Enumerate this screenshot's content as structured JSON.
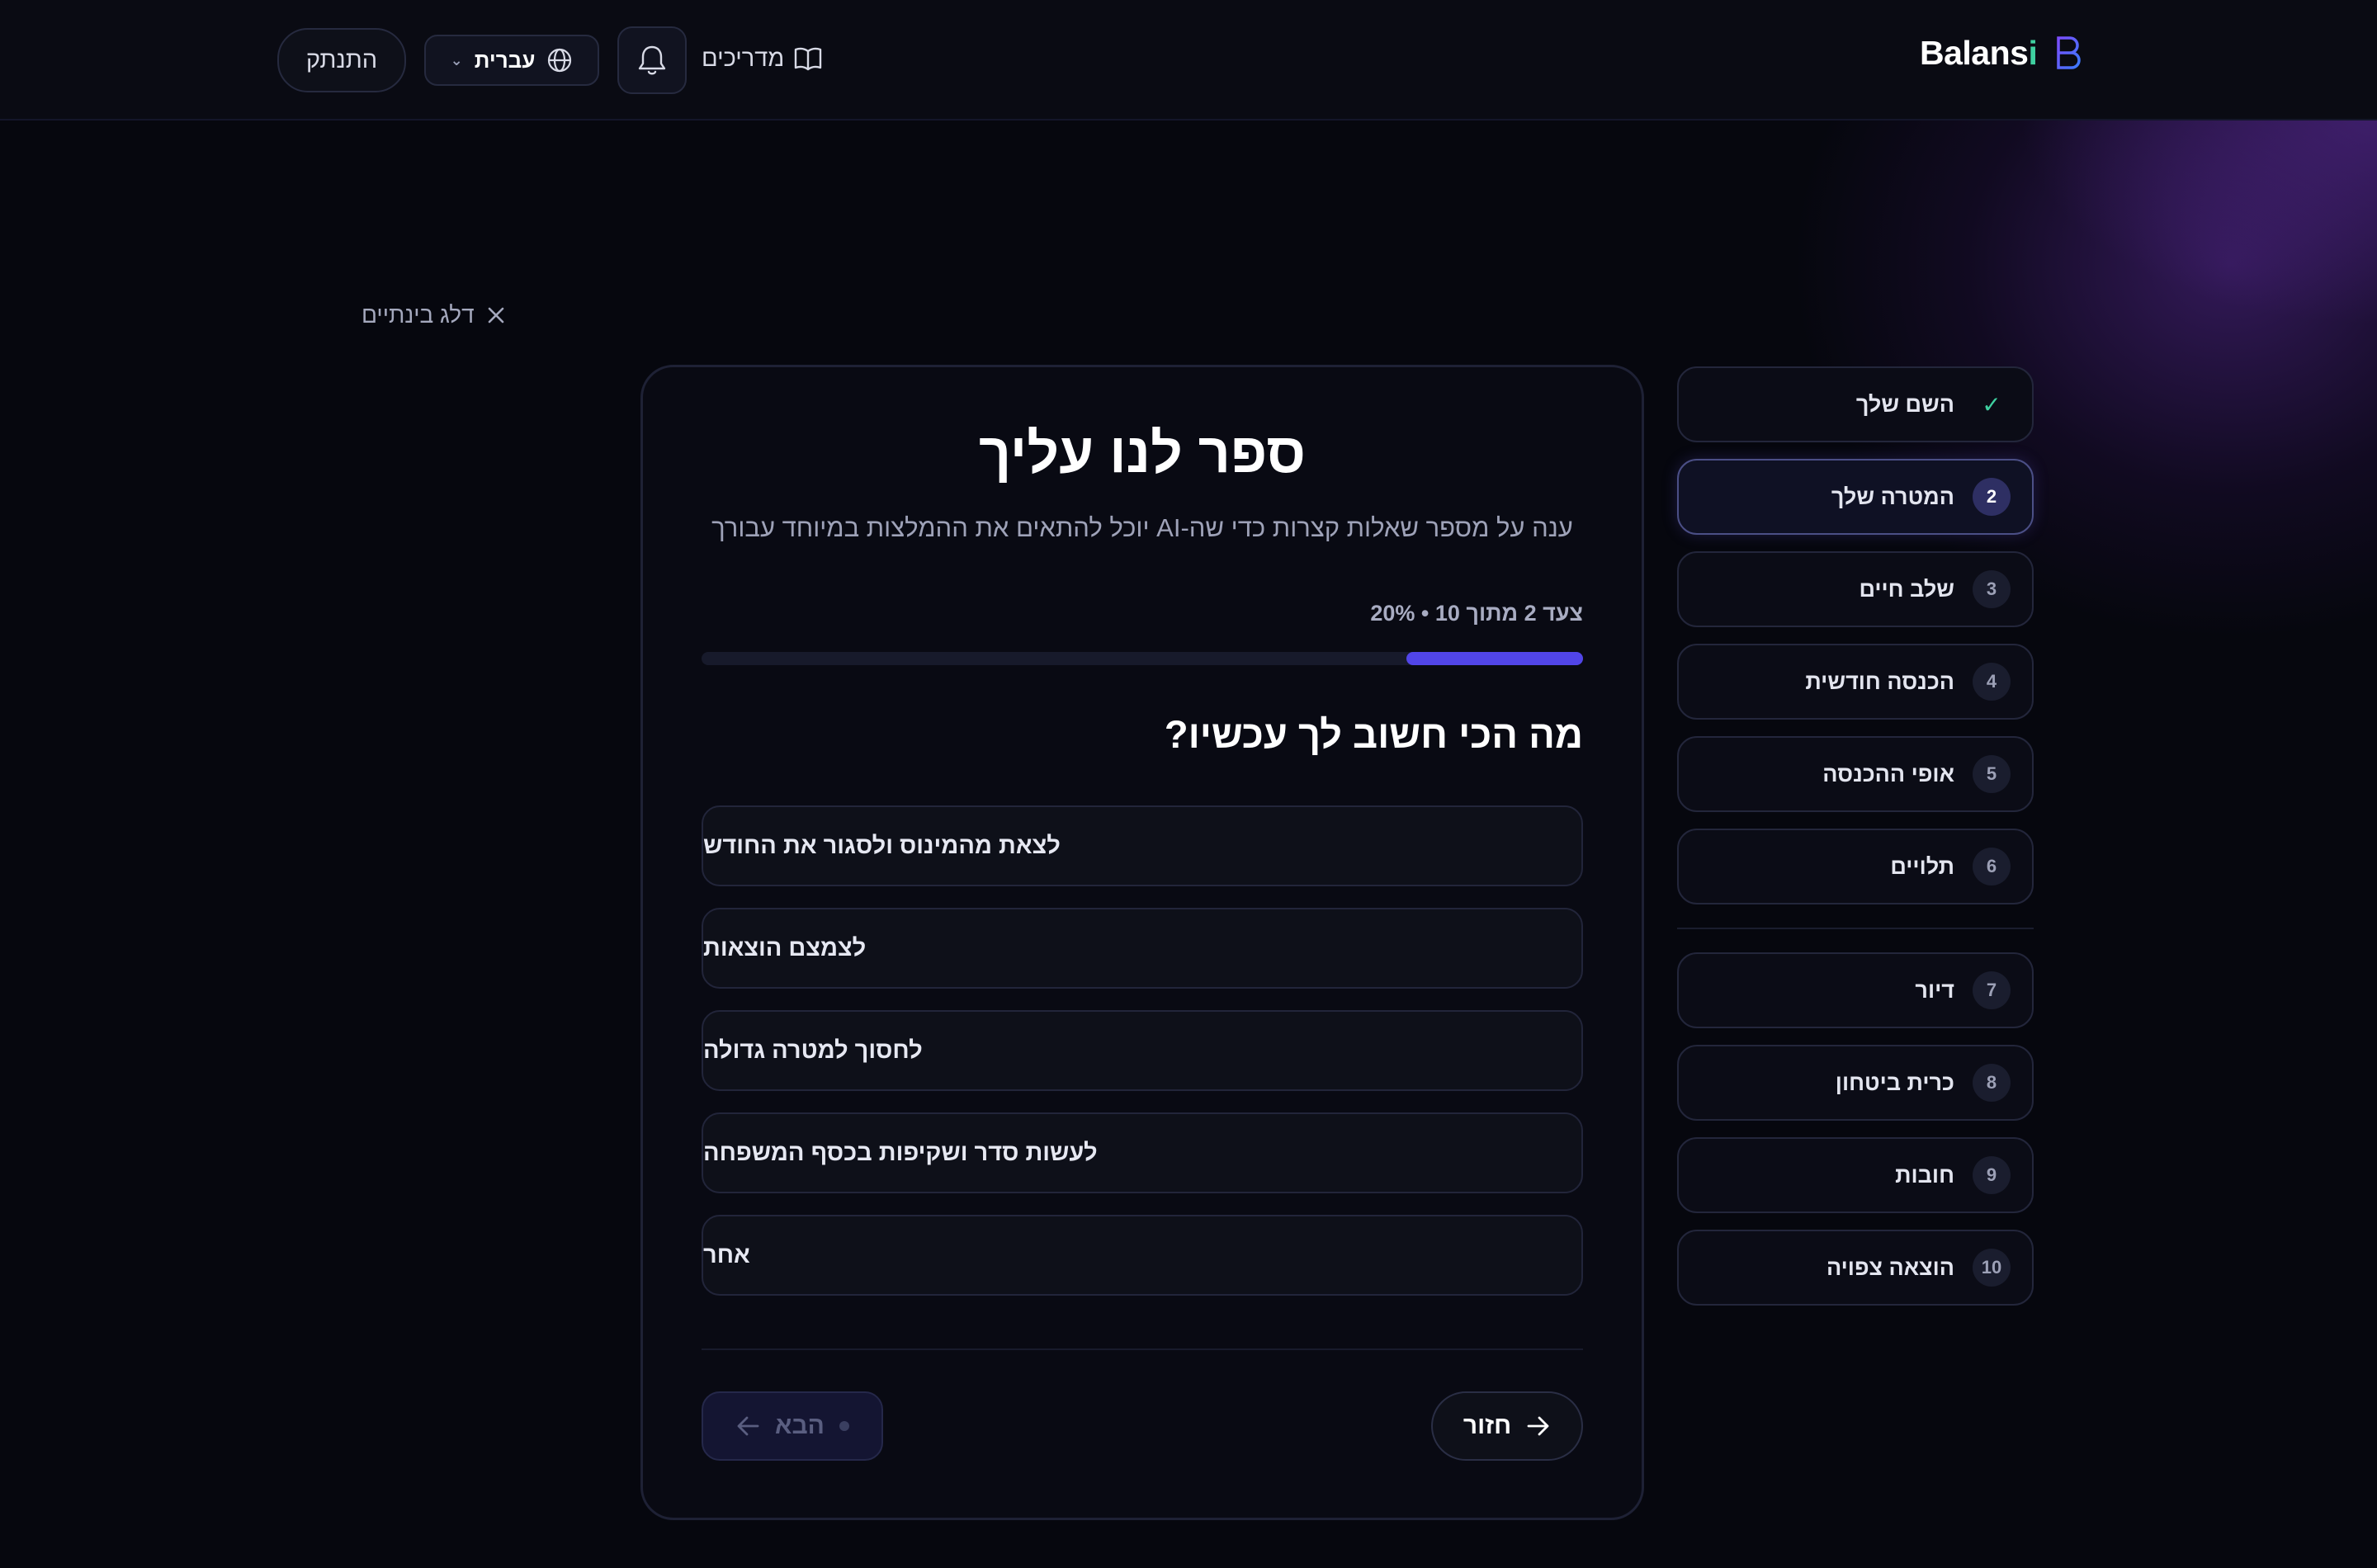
{
  "header": {
    "logo_main": "Balans",
    "logo_accent": "i",
    "logout_label": "התנתק",
    "language_label": "עברית",
    "guides_label": "מדריכים"
  },
  "skip_label": "דלג בינתיים",
  "card": {
    "title": "ספר לנו עליך",
    "subtitle": "ענה על מספר שאלות קצרות כדי שה-AI יוכל להתאים את ההמלצות במיוחד עבורך",
    "progress_text": "צעד 2 מתוך 10 • 20%",
    "progress_fraction": 0.2,
    "question": "מה הכי חשוב לך עכשיו?",
    "options": [
      "לצאת מהמינוס ולסגור את החודש",
      "לצמצם הוצאות",
      "לחסוך למטרה גדולה",
      "לעשות סדר ושקיפות בכסף המשפחה",
      "אחר"
    ],
    "back_label": "חזור",
    "next_label": "הבא"
  },
  "steps": [
    {
      "num": "✓",
      "label": "השם שלך",
      "state": "done"
    },
    {
      "num": "2",
      "label": "המטרה שלך",
      "state": "active"
    },
    {
      "num": "3",
      "label": "שלב חיים",
      "state": "pending"
    },
    {
      "num": "4",
      "label": "הכנסה חודשית",
      "state": "pending"
    },
    {
      "num": "5",
      "label": "אופי ההכנסה",
      "state": "pending"
    },
    {
      "num": "6",
      "label": "תלויים",
      "state": "pending"
    },
    {
      "num": "7",
      "label": "דיור",
      "state": "pending"
    },
    {
      "num": "8",
      "label": "כרית ביטחון",
      "state": "pending"
    },
    {
      "num": "9",
      "label": "חובות",
      "state": "pending"
    },
    {
      "num": "10",
      "label": "הוצאה צפויה",
      "state": "pending"
    }
  ],
  "colors": {
    "accent": "#5145e8",
    "success": "#3fd0a0",
    "background": "#06070e"
  }
}
